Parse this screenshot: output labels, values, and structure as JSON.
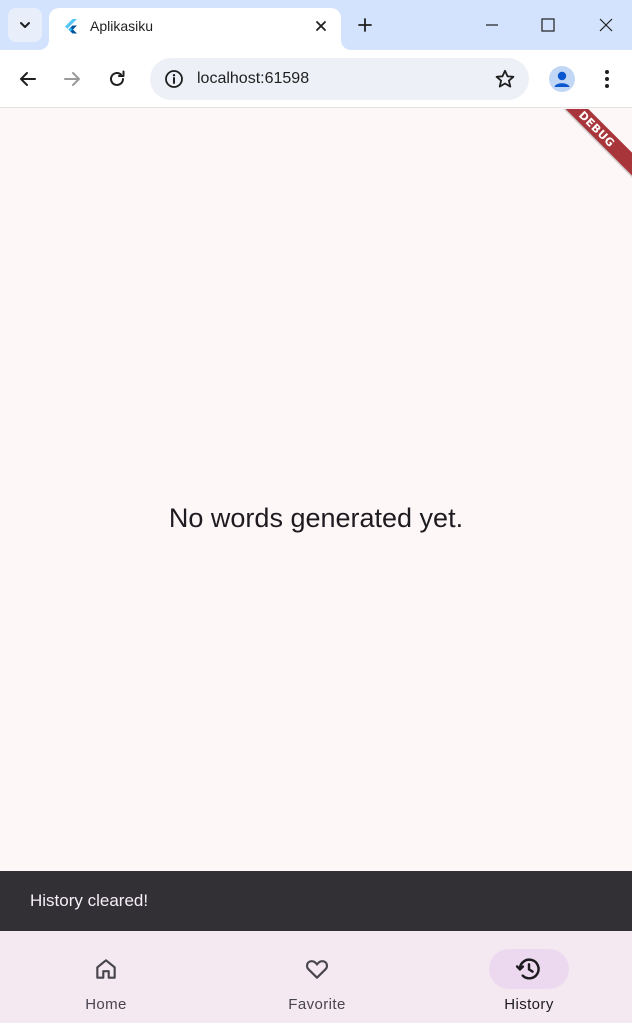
{
  "browser": {
    "tab_title": "Aplikasiku",
    "url": "localhost:61598",
    "icons": {
      "tab_search": "chevron-down-icon",
      "tab_close": "close-icon",
      "new_tab": "plus-icon",
      "minimize": "minimize-icon",
      "maximize": "maximize-icon",
      "close_window": "close-icon",
      "back": "back-arrow-icon",
      "forward": "forward-arrow-icon",
      "reload": "reload-icon",
      "site_info": "info-icon",
      "bookmark": "star-icon",
      "profile": "profile-icon",
      "menu": "kebab-menu-icon"
    }
  },
  "app": {
    "debug_label": "DEBUG",
    "empty_message": "No words generated yet.",
    "snackbar": "History cleared!",
    "nav": [
      {
        "label": "Home",
        "icon": "home-icon",
        "active": false
      },
      {
        "label": "Favorite",
        "icon": "heart-icon",
        "active": false
      },
      {
        "label": "History",
        "icon": "history-icon",
        "active": true
      }
    ]
  },
  "colors": {
    "tabstrip_bg": "#d3e3fd",
    "app_bg": "#fef7f8",
    "snackbar_bg": "#322f35",
    "navbar_bg": "#f4e9f0",
    "active_indicator": "#ecd9ef",
    "debug_banner": "#a8353a"
  }
}
